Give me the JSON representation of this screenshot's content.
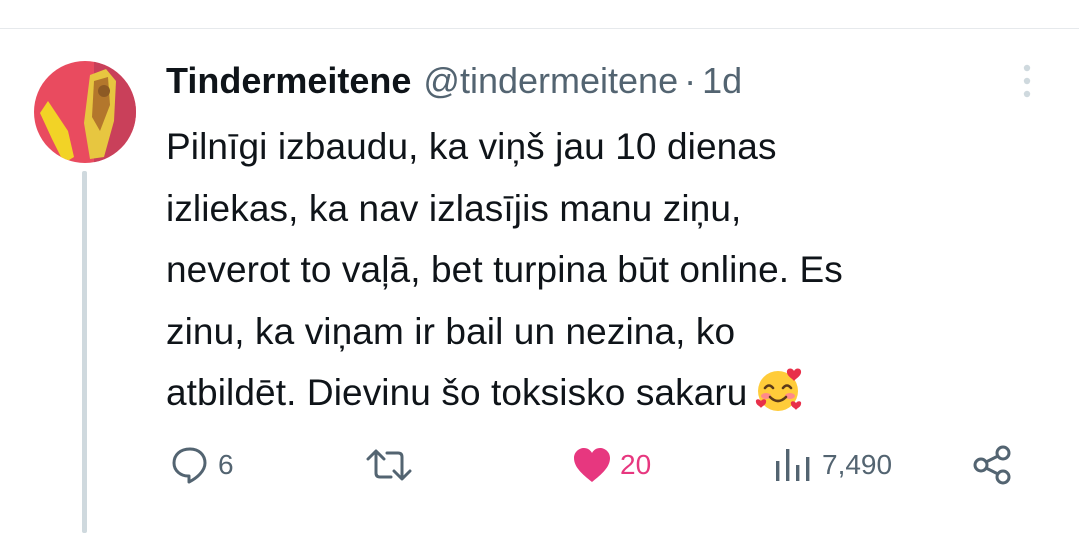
{
  "tweet": {
    "display_name": "Tindermeitene",
    "handle": "@tindermeitene",
    "separator": "·",
    "time": "1d",
    "text_lines": [
      "Pilnīgi izbaudu, ka viņš jau 10 dienas",
      "izliekas, ka nav izlasījis manu ziņu,",
      "neverot to vaļā, bet turpina būt online. Es",
      "zinu, ka viņam ir bail un nezina, ko",
      "atbildēt. Dievinu šo toksisko sakaru"
    ],
    "emoji": "smiling-face-with-hearts",
    "avatar_icon": "profile-photo-avatar"
  },
  "actions": {
    "reply": {
      "icon": "reply-icon",
      "count": "6"
    },
    "retweet": {
      "icon": "retweet-icon",
      "count": ""
    },
    "like": {
      "icon": "heart-icon",
      "count": "20",
      "active": true
    },
    "views": {
      "icon": "views-icon",
      "count": "7,490"
    },
    "share": {
      "icon": "share-icon"
    }
  },
  "colors": {
    "text": "#0f1419",
    "secondary": "#536471",
    "like": "#e7377f",
    "thread_line": "#cfd9de",
    "divider": "#e6e9ec"
  }
}
